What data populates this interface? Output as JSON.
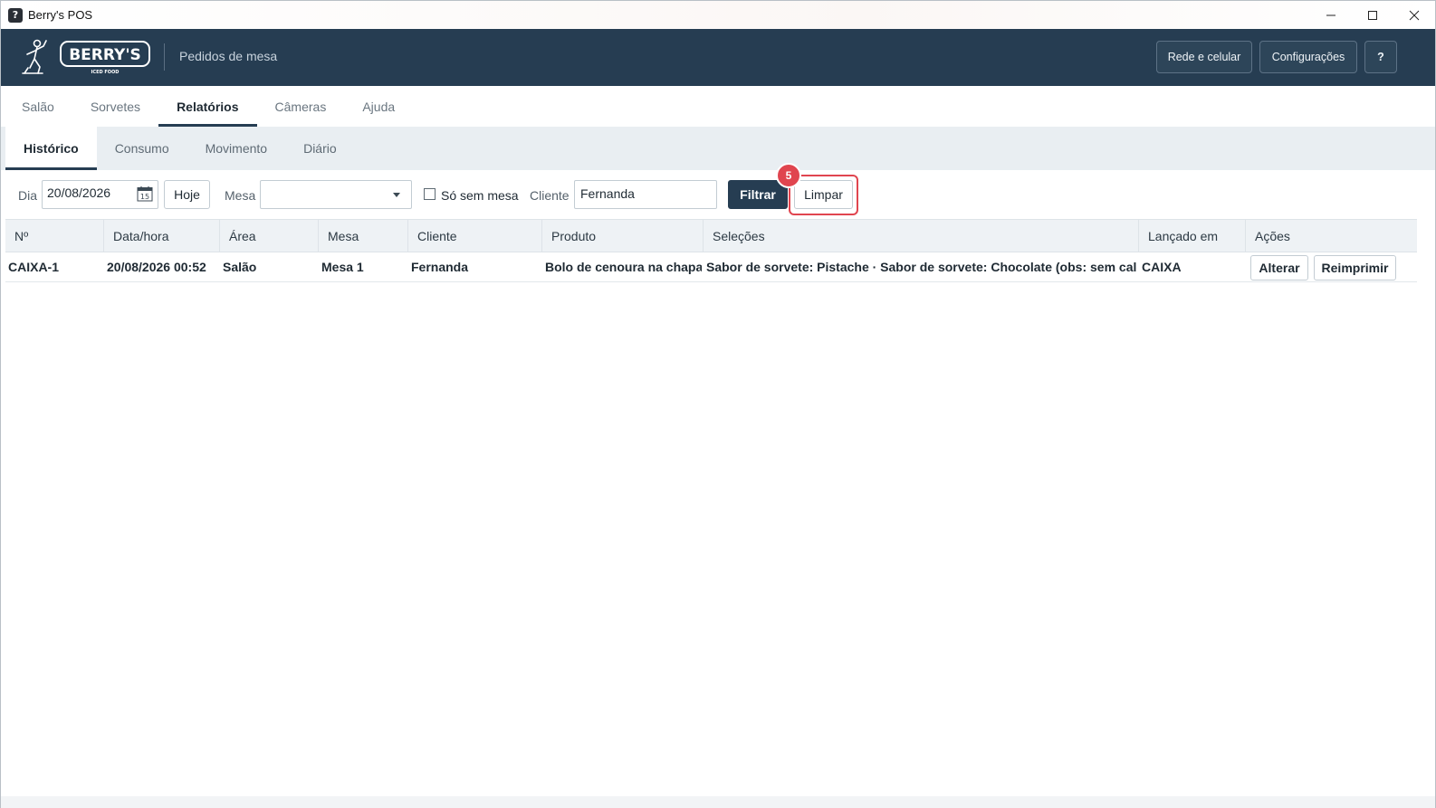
{
  "window": {
    "title": "Berry's POS",
    "app_icon_glyph": "?",
    "controls": [
      "minimize-icon",
      "maximize-icon",
      "close-icon"
    ]
  },
  "header": {
    "logo_text": "BERRY'S",
    "logo_tagline": "ICED FOOD",
    "subtitle": "Pedidos de mesa",
    "buttons": {
      "network": "Rede e celular",
      "settings": "Configurações",
      "help": "?"
    },
    "bg_color": "#263d52"
  },
  "main_tabs": [
    {
      "label": "Salão",
      "active": false
    },
    {
      "label": "Sorvetes",
      "active": false
    },
    {
      "label": "Relatórios",
      "active": true
    },
    {
      "label": "Câmeras",
      "active": false
    },
    {
      "label": "Ajuda",
      "active": false
    }
  ],
  "sub_tabs": [
    {
      "label": "Histórico",
      "active": true
    },
    {
      "label": "Consumo",
      "active": false
    },
    {
      "label": "Movimento",
      "active": false
    },
    {
      "label": "Diário",
      "active": false
    }
  ],
  "filters": {
    "day_label": "Dia",
    "day_value": "20/08/2026",
    "calendar_icon": "calendar-icon",
    "calendar_day": "15",
    "today_button": "Hoje",
    "table_label": "Mesa",
    "table_value": "",
    "no_table_label": "Só sem mesa",
    "no_table_checked": false,
    "client_label": "Cliente",
    "client_value": "Fernanda",
    "filter_button": "Filtrar",
    "clear_button": "Limpar",
    "step_badge": "5",
    "highlight_color": "#e0454f"
  },
  "table": {
    "columns": [
      "Nº",
      "Data/hora",
      "Área",
      "Mesa",
      "Cliente",
      "Produto",
      "Seleções",
      "Lançado em",
      "Ações"
    ],
    "rows": [
      {
        "numero": "CAIXA-1",
        "data_hora": "20/08/2026 00:52",
        "area": "Salão",
        "mesa": "Mesa 1",
        "cliente": "Fernanda",
        "produto": "Bolo de cenoura na chapa, I",
        "selecoes": "Sabor de sorvete: Pistache · Sabor de sorvete: Chocolate (obs: sem calda)",
        "lancado_em": "CAIXA",
        "acoes": [
          "Alterar",
          "Reimprimir"
        ]
      }
    ]
  }
}
